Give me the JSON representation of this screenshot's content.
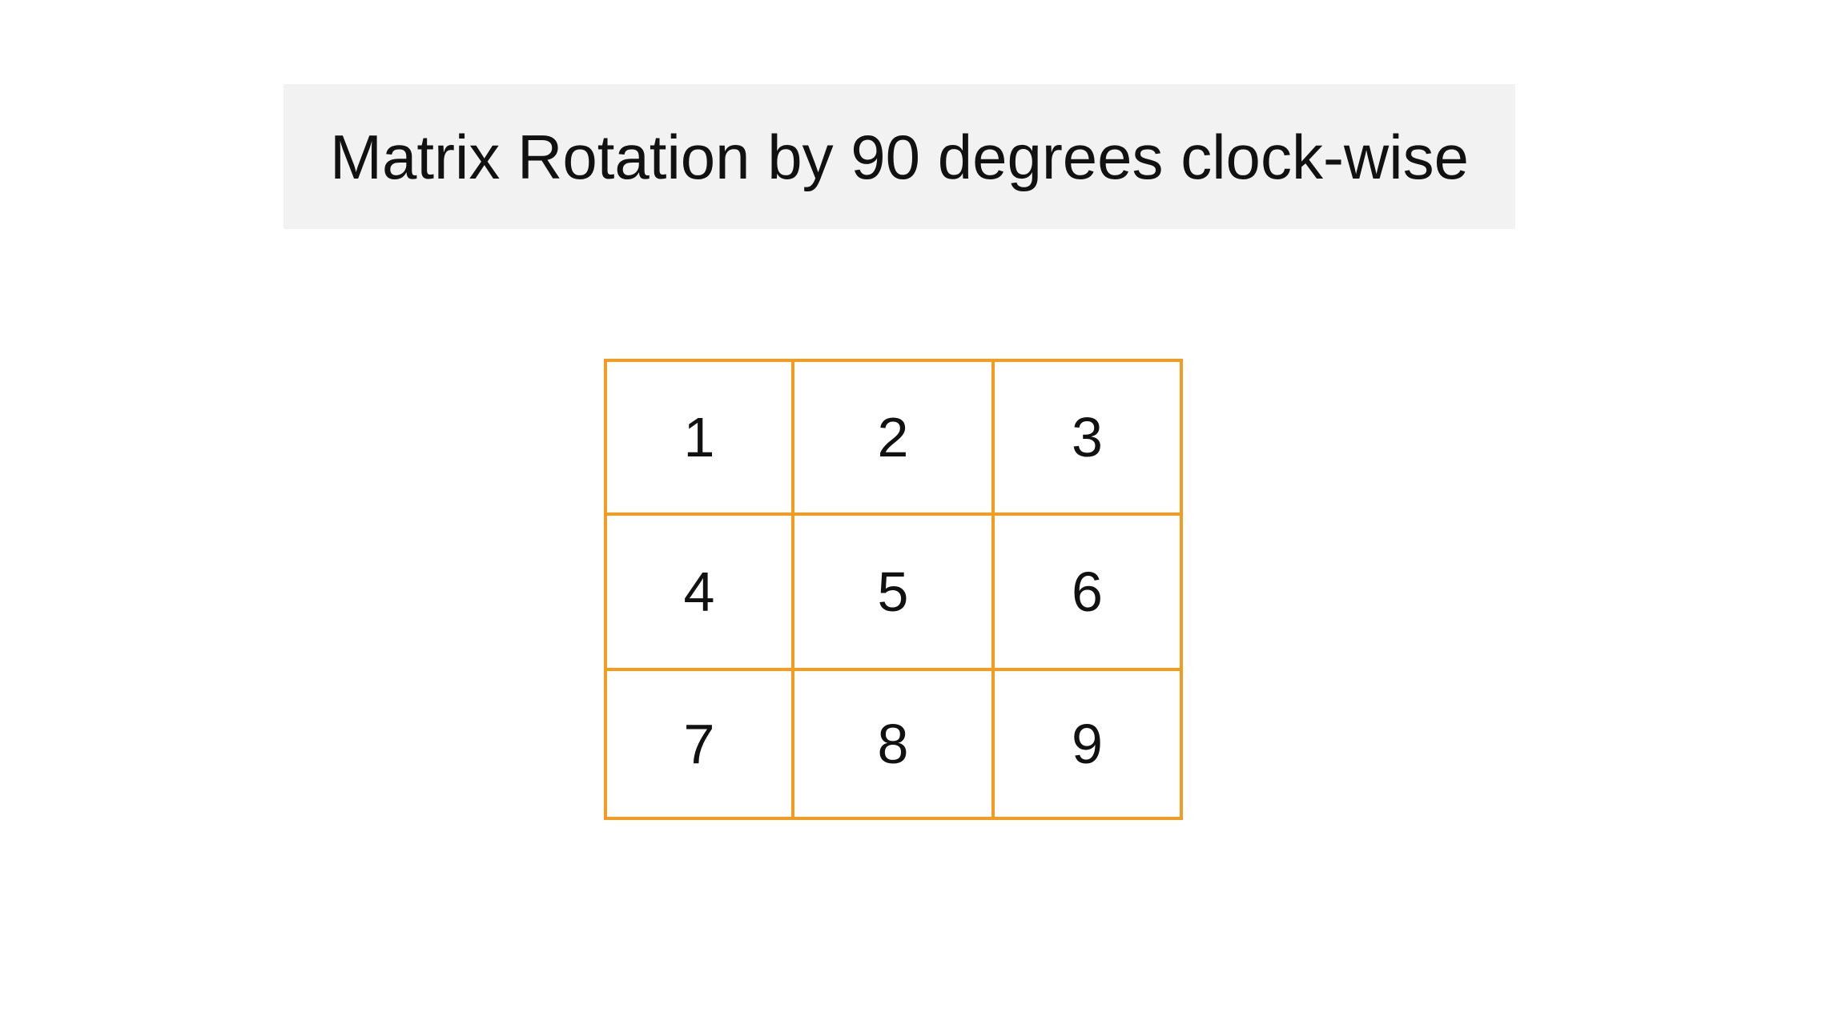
{
  "title": "Matrix Rotation by 90 degrees clock-wise",
  "matrix": {
    "rows": [
      [
        "1",
        "2",
        "3"
      ],
      [
        "4",
        "5",
        "6"
      ],
      [
        "7",
        "8",
        "9"
      ]
    ]
  },
  "colors": {
    "grid_border": "#f39c1f",
    "title_background": "#f2f2f2",
    "text": "#111111"
  }
}
